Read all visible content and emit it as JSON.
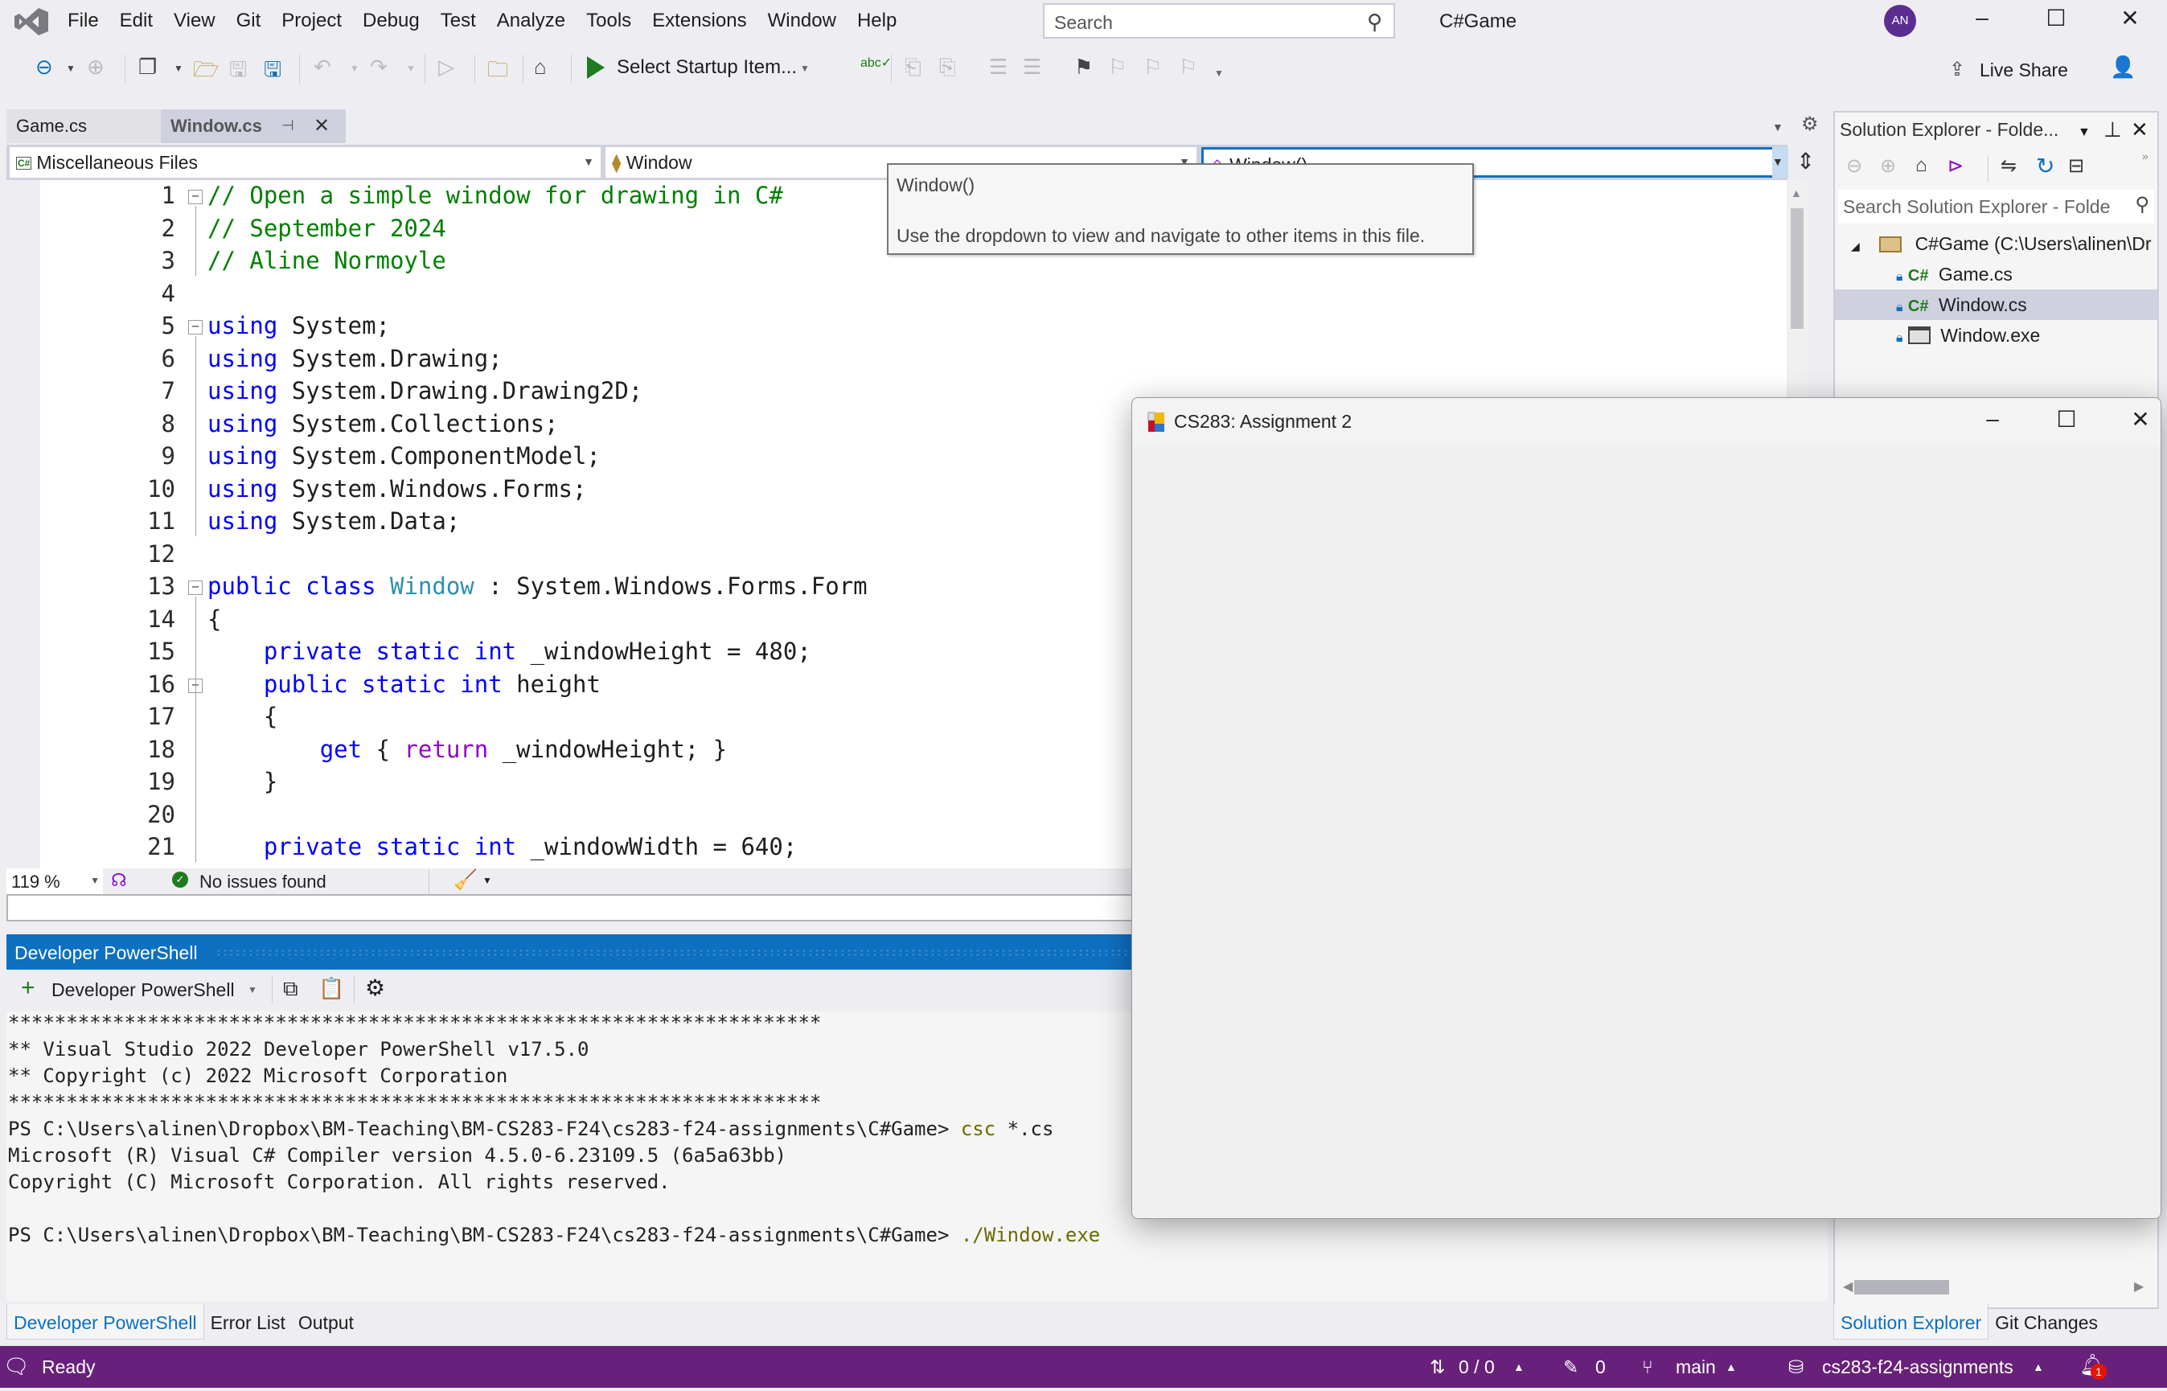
{
  "titlebar": {
    "menu": [
      "File",
      "Edit",
      "View",
      "Git",
      "Project",
      "Debug",
      "Test",
      "Analyze",
      "Tools",
      "Extensions",
      "Window",
      "Help"
    ],
    "search_placeholder": "Search",
    "app_title": "C#Game",
    "avatar_initials": "AN",
    "minimize": "–",
    "maximize": "☐",
    "close": "✕"
  },
  "toolbar": {
    "startup_item": "Select Startup Item...",
    "live_share": "Live Share"
  },
  "tabs": [
    {
      "label": "Game.cs",
      "active": false
    },
    {
      "label": "Window.cs",
      "active": true
    }
  ],
  "navbar": {
    "project": "Miscellaneous Files",
    "type": "Window",
    "member": "Window()"
  },
  "tooltip": {
    "title": "Window()",
    "body": "Use the dropdown to view and navigate to other items in this file."
  },
  "editor": {
    "lines": [
      {
        "n": "1",
        "tokens": [
          {
            "t": "// Open a simple window for drawing in C#",
            "c": "cmt"
          }
        ]
      },
      {
        "n": "2",
        "tokens": [
          {
            "t": "// September 2024",
            "c": "cmt"
          }
        ]
      },
      {
        "n": "3",
        "tokens": [
          {
            "t": "// Aline Normoyle",
            "c": "cmt"
          }
        ]
      },
      {
        "n": "4",
        "tokens": []
      },
      {
        "n": "5",
        "tokens": [
          {
            "t": "using",
            "c": "kw"
          },
          {
            "t": " System;",
            "c": ""
          }
        ]
      },
      {
        "n": "6",
        "tokens": [
          {
            "t": "using",
            "c": "kw"
          },
          {
            "t": " System.Drawing;",
            "c": ""
          }
        ]
      },
      {
        "n": "7",
        "tokens": [
          {
            "t": "using",
            "c": "kw"
          },
          {
            "t": " System.Drawing.Drawing2D;",
            "c": ""
          }
        ]
      },
      {
        "n": "8",
        "tokens": [
          {
            "t": "using",
            "c": "kw"
          },
          {
            "t": " System.Collections;",
            "c": ""
          }
        ]
      },
      {
        "n": "9",
        "tokens": [
          {
            "t": "using",
            "c": "kw"
          },
          {
            "t": " System.ComponentModel;",
            "c": ""
          }
        ]
      },
      {
        "n": "10",
        "tokens": [
          {
            "t": "using",
            "c": "kw"
          },
          {
            "t": " System.Windows.Forms;",
            "c": ""
          }
        ]
      },
      {
        "n": "11",
        "tokens": [
          {
            "t": "using",
            "c": "kw"
          },
          {
            "t": " System.Data;",
            "c": ""
          }
        ]
      },
      {
        "n": "12",
        "tokens": []
      },
      {
        "n": "13",
        "tokens": [
          {
            "t": "public class ",
            "c": "kw"
          },
          {
            "t": "Window",
            "c": "ty"
          },
          {
            "t": " : System.Windows.Forms.Form",
            "c": ""
          }
        ]
      },
      {
        "n": "14",
        "tokens": [
          {
            "t": "{",
            "c": ""
          }
        ]
      },
      {
        "n": "15",
        "tokens": [
          {
            "t": "    ",
            "c": ""
          },
          {
            "t": "private static int",
            "c": "kw"
          },
          {
            "t": " _windowHeight = 480;",
            "c": ""
          }
        ]
      },
      {
        "n": "16",
        "tokens": [
          {
            "t": "    ",
            "c": ""
          },
          {
            "t": "public static int",
            "c": "kw"
          },
          {
            "t": " height",
            "c": ""
          }
        ]
      },
      {
        "n": "17",
        "tokens": [
          {
            "t": "    {",
            "c": ""
          }
        ]
      },
      {
        "n": "18",
        "tokens": [
          {
            "t": "        ",
            "c": ""
          },
          {
            "t": "get",
            "c": "kw"
          },
          {
            "t": " { ",
            "c": ""
          },
          {
            "t": "return",
            "c": "ctl"
          },
          {
            "t": " _windowHeight; }",
            "c": ""
          }
        ]
      },
      {
        "n": "19",
        "tokens": [
          {
            "t": "    }",
            "c": ""
          }
        ]
      },
      {
        "n": "20",
        "tokens": []
      },
      {
        "n": "21",
        "tokens": [
          {
            "t": "    ",
            "c": ""
          },
          {
            "t": "private static int",
            "c": "kw"
          },
          {
            "t": " _windowWidth = 640;",
            "c": ""
          }
        ]
      }
    ],
    "zoom": "119 %",
    "issues": "No issues found"
  },
  "powershell": {
    "header": "Developer PowerShell",
    "new_terminal": "Developer PowerShell",
    "lines": [
      {
        "text": "**********************************************************************",
        "cmd": ""
      },
      {
        "text": "** Visual Studio 2022 Developer PowerShell v17.5.0",
        "cmd": ""
      },
      {
        "text": "** Copyright (c) 2022 Microsoft Corporation",
        "cmd": ""
      },
      {
        "text": "**********************************************************************",
        "cmd": ""
      },
      {
        "text": "PS C:\\Users\\alinen\\Dropbox\\BM-Teaching\\BM-CS283-F24\\cs283-f24-assignments\\C#Game> ",
        "cmd": "csc",
        "rest": " *.cs"
      },
      {
        "text": "Microsoft (R) Visual C# Compiler version 4.5.0-6.23109.5 (6a5a63bb)",
        "cmd": ""
      },
      {
        "text": "Copyright (C) Microsoft Corporation. All rights reserved.",
        "cmd": ""
      },
      {
        "text": "",
        "cmd": ""
      },
      {
        "text": "PS C:\\Users\\alinen\\Dropbox\\BM-Teaching\\BM-CS283-F24\\cs283-f24-assignments\\C#Game> ",
        "cmd": "./Window.exe",
        "rest": ""
      }
    ]
  },
  "bottom_tabs": [
    "Developer PowerShell",
    "Error List",
    "Output"
  ],
  "solution_explorer": {
    "title": "Solution Explorer - Folde...",
    "search_placeholder": "Search Solution Explorer - Folde",
    "root": "C#Game (C:\\Users\\alinen\\Dr",
    "items": [
      {
        "label": "Game.cs",
        "type": "cs",
        "selected": false
      },
      {
        "label": "Window.cs",
        "type": "cs",
        "selected": true
      },
      {
        "label": "Window.exe",
        "type": "exe",
        "selected": false
      }
    ],
    "tabs": [
      "Solution Explorer",
      "Git Changes"
    ]
  },
  "statusbar": {
    "ready": "Ready",
    "sync": "0 / 0",
    "pending_changes": "0",
    "branch": "main",
    "repo": "cs283-f24-assignments",
    "notifications": "1"
  },
  "form_window": {
    "title": "CS283: Assignment 2"
  },
  "colors": {
    "accent": "#0e70c0",
    "statusbar": "#68217a",
    "comment": "#008000",
    "keyword": "#0000ff",
    "type": "#2b91af",
    "control": "#8f08c4"
  }
}
